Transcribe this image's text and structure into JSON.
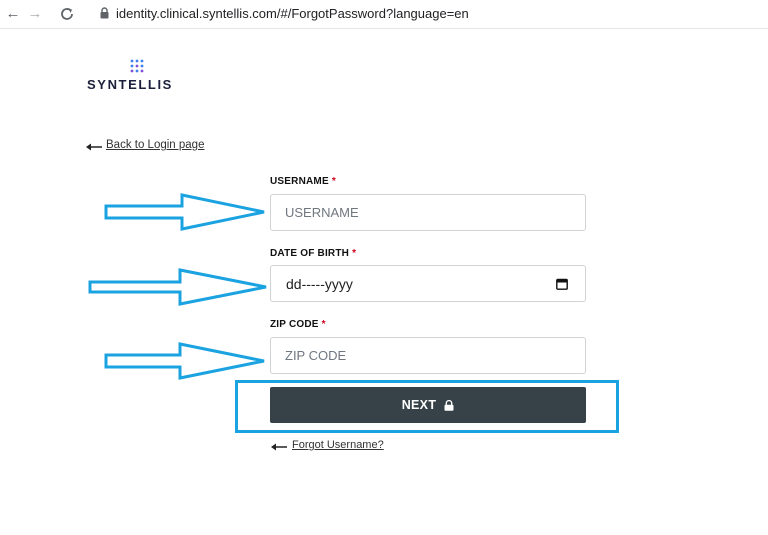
{
  "browser": {
    "url": "identity.clinical.syntellis.com/#/ForgotPassword?language=en",
    "back_icon": "arrow-left-icon",
    "forward_icon": "arrow-right-icon",
    "reload_icon": "reload-icon",
    "lock_icon": "lock-icon"
  },
  "logo": {
    "text": "SYNTELLIS",
    "icon": "dot-grid-icon",
    "dot_color": "#3f7fea"
  },
  "back_link": {
    "label": "Back to Login page"
  },
  "form": {
    "username": {
      "label": "USERNAME",
      "required_mark": "*",
      "placeholder": "USERNAME"
    },
    "dob": {
      "label": "DATE OF BIRTH",
      "required_mark": "*",
      "value": "dd-----yyyy",
      "icon": "calendar-icon"
    },
    "zip": {
      "label": "ZIP CODE",
      "required_mark": "*",
      "placeholder": "ZIP CODE"
    },
    "next_button": {
      "label": "NEXT",
      "icon": "lock-icon",
      "color": "#374248"
    },
    "forgot_username": {
      "label": "Forgot Username?"
    }
  },
  "annotations": {
    "color": "#1aa3e0",
    "arrow_icon": "outline-arrow-right-icon"
  }
}
